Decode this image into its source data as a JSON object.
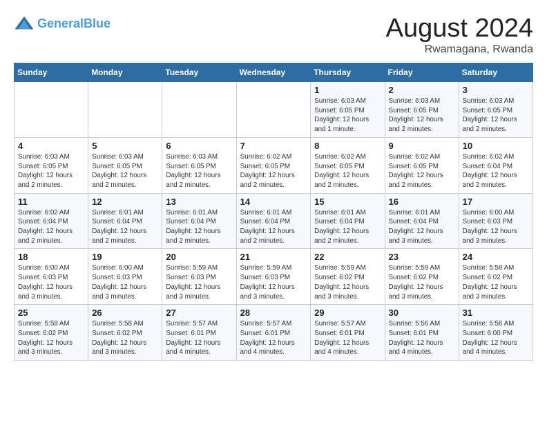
{
  "header": {
    "logo_line1": "General",
    "logo_line2": "Blue",
    "month_title": "August 2024",
    "location": "Rwamagana, Rwanda"
  },
  "weekdays": [
    "Sunday",
    "Monday",
    "Tuesday",
    "Wednesday",
    "Thursday",
    "Friday",
    "Saturday"
  ],
  "weeks": [
    [
      {
        "day": "",
        "info": ""
      },
      {
        "day": "",
        "info": ""
      },
      {
        "day": "",
        "info": ""
      },
      {
        "day": "",
        "info": ""
      },
      {
        "day": "1",
        "info": "Sunrise: 6:03 AM\nSunset: 6:05 PM\nDaylight: 12 hours\nand 1 minute."
      },
      {
        "day": "2",
        "info": "Sunrise: 6:03 AM\nSunset: 6:05 PM\nDaylight: 12 hours\nand 2 minutes."
      },
      {
        "day": "3",
        "info": "Sunrise: 6:03 AM\nSunset: 6:05 PM\nDaylight: 12 hours\nand 2 minutes."
      }
    ],
    [
      {
        "day": "4",
        "info": "Sunrise: 6:03 AM\nSunset: 6:05 PM\nDaylight: 12 hours\nand 2 minutes."
      },
      {
        "day": "5",
        "info": "Sunrise: 6:03 AM\nSunset: 6:05 PM\nDaylight: 12 hours\nand 2 minutes."
      },
      {
        "day": "6",
        "info": "Sunrise: 6:03 AM\nSunset: 6:05 PM\nDaylight: 12 hours\nand 2 minutes."
      },
      {
        "day": "7",
        "info": "Sunrise: 6:02 AM\nSunset: 6:05 PM\nDaylight: 12 hours\nand 2 minutes."
      },
      {
        "day": "8",
        "info": "Sunrise: 6:02 AM\nSunset: 6:05 PM\nDaylight: 12 hours\nand 2 minutes."
      },
      {
        "day": "9",
        "info": "Sunrise: 6:02 AM\nSunset: 6:05 PM\nDaylight: 12 hours\nand 2 minutes."
      },
      {
        "day": "10",
        "info": "Sunrise: 6:02 AM\nSunset: 6:04 PM\nDaylight: 12 hours\nand 2 minutes."
      }
    ],
    [
      {
        "day": "11",
        "info": "Sunrise: 6:02 AM\nSunset: 6:04 PM\nDaylight: 12 hours\nand 2 minutes."
      },
      {
        "day": "12",
        "info": "Sunrise: 6:01 AM\nSunset: 6:04 PM\nDaylight: 12 hours\nand 2 minutes."
      },
      {
        "day": "13",
        "info": "Sunrise: 6:01 AM\nSunset: 6:04 PM\nDaylight: 12 hours\nand 2 minutes."
      },
      {
        "day": "14",
        "info": "Sunrise: 6:01 AM\nSunset: 6:04 PM\nDaylight: 12 hours\nand 2 minutes."
      },
      {
        "day": "15",
        "info": "Sunrise: 6:01 AM\nSunset: 6:04 PM\nDaylight: 12 hours\nand 2 minutes."
      },
      {
        "day": "16",
        "info": "Sunrise: 6:01 AM\nSunset: 6:04 PM\nDaylight: 12 hours\nand 3 minutes."
      },
      {
        "day": "17",
        "info": "Sunrise: 6:00 AM\nSunset: 6:03 PM\nDaylight: 12 hours\nand 3 minutes."
      }
    ],
    [
      {
        "day": "18",
        "info": "Sunrise: 6:00 AM\nSunset: 6:03 PM\nDaylight: 12 hours\nand 3 minutes."
      },
      {
        "day": "19",
        "info": "Sunrise: 6:00 AM\nSunset: 6:03 PM\nDaylight: 12 hours\nand 3 minutes."
      },
      {
        "day": "20",
        "info": "Sunrise: 5:59 AM\nSunset: 6:03 PM\nDaylight: 12 hours\nand 3 minutes."
      },
      {
        "day": "21",
        "info": "Sunrise: 5:59 AM\nSunset: 6:03 PM\nDaylight: 12 hours\nand 3 minutes."
      },
      {
        "day": "22",
        "info": "Sunrise: 5:59 AM\nSunset: 6:02 PM\nDaylight: 12 hours\nand 3 minutes."
      },
      {
        "day": "23",
        "info": "Sunrise: 5:59 AM\nSunset: 6:02 PM\nDaylight: 12 hours\nand 3 minutes."
      },
      {
        "day": "24",
        "info": "Sunrise: 5:58 AM\nSunset: 6:02 PM\nDaylight: 12 hours\nand 3 minutes."
      }
    ],
    [
      {
        "day": "25",
        "info": "Sunrise: 5:58 AM\nSunset: 6:02 PM\nDaylight: 12 hours\nand 3 minutes."
      },
      {
        "day": "26",
        "info": "Sunrise: 5:58 AM\nSunset: 6:02 PM\nDaylight: 12 hours\nand 3 minutes."
      },
      {
        "day": "27",
        "info": "Sunrise: 5:57 AM\nSunset: 6:01 PM\nDaylight: 12 hours\nand 4 minutes."
      },
      {
        "day": "28",
        "info": "Sunrise: 5:57 AM\nSunset: 6:01 PM\nDaylight: 12 hours\nand 4 minutes."
      },
      {
        "day": "29",
        "info": "Sunrise: 5:57 AM\nSunset: 6:01 PM\nDaylight: 12 hours\nand 4 minutes."
      },
      {
        "day": "30",
        "info": "Sunrise: 5:56 AM\nSunset: 6:01 PM\nDaylight: 12 hours\nand 4 minutes."
      },
      {
        "day": "31",
        "info": "Sunrise: 5:56 AM\nSunset: 6:00 PM\nDaylight: 12 hours\nand 4 minutes."
      }
    ]
  ]
}
